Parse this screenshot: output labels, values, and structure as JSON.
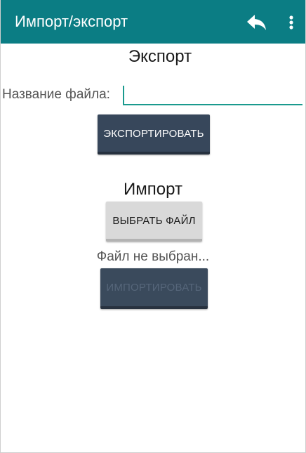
{
  "appbar": {
    "title": "Импорт/экспорт",
    "background_color": "#0b7d84",
    "actions": [
      {
        "icon": "reply-icon"
      },
      {
        "icon": "more-vertical-icon"
      }
    ]
  },
  "export": {
    "section_title": "Экспорт",
    "filename_label": "Название файла:",
    "filename_value": "",
    "export_button_label": "ЭКСПОРТИРОВАТЬ"
  },
  "import": {
    "section_title": "Импорт",
    "choose_file_button_label": "ВЫБРАТЬ ФАЙЛ",
    "file_status": "Файл не выбран...",
    "import_button_label": "ИМПОРТИРОВАТЬ",
    "import_button_enabled": false
  },
  "colors": {
    "accent": "#1a9a8e",
    "dark_button": "#37475b",
    "light_button": "#d9d9d9"
  }
}
